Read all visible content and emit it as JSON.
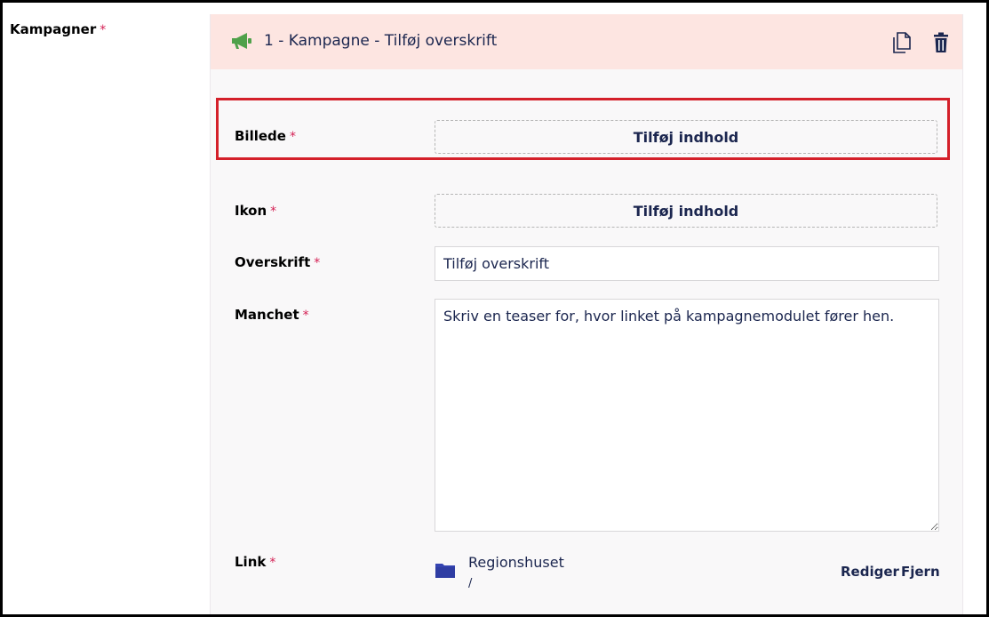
{
  "field": {
    "label": "Kampagner",
    "required_mark": "*"
  },
  "block": {
    "title": "1 - Kampagne - Tilføj overskrift",
    "icon": "megaphone-icon",
    "icon_color": "#4fa14a",
    "actions": {
      "copy_icon": "copy-icon",
      "delete_icon": "trash-icon"
    }
  },
  "properties": {
    "image": {
      "label": "Billede",
      "required_mark": "*",
      "button": "Tilføj indhold"
    },
    "icon": {
      "label": "Ikon",
      "required_mark": "*",
      "button": "Tilføj indhold"
    },
    "headline": {
      "label": "Overskrift",
      "required_mark": "*",
      "value": "Tilføj overskrift"
    },
    "teaser": {
      "label": "Manchet",
      "required_mark": "*",
      "value": "Skriv en teaser for, hvor linket på kampagnemodulet fører hen."
    },
    "link": {
      "label": "Link",
      "required_mark": "*",
      "name": "Regionshuset",
      "path": "/",
      "edit": "Rediger",
      "remove": "Fjern"
    }
  },
  "colors": {
    "header_bg": "#fde5e1",
    "highlight": "#d4202a",
    "required": "#d42054",
    "folder": "#3544b1"
  }
}
